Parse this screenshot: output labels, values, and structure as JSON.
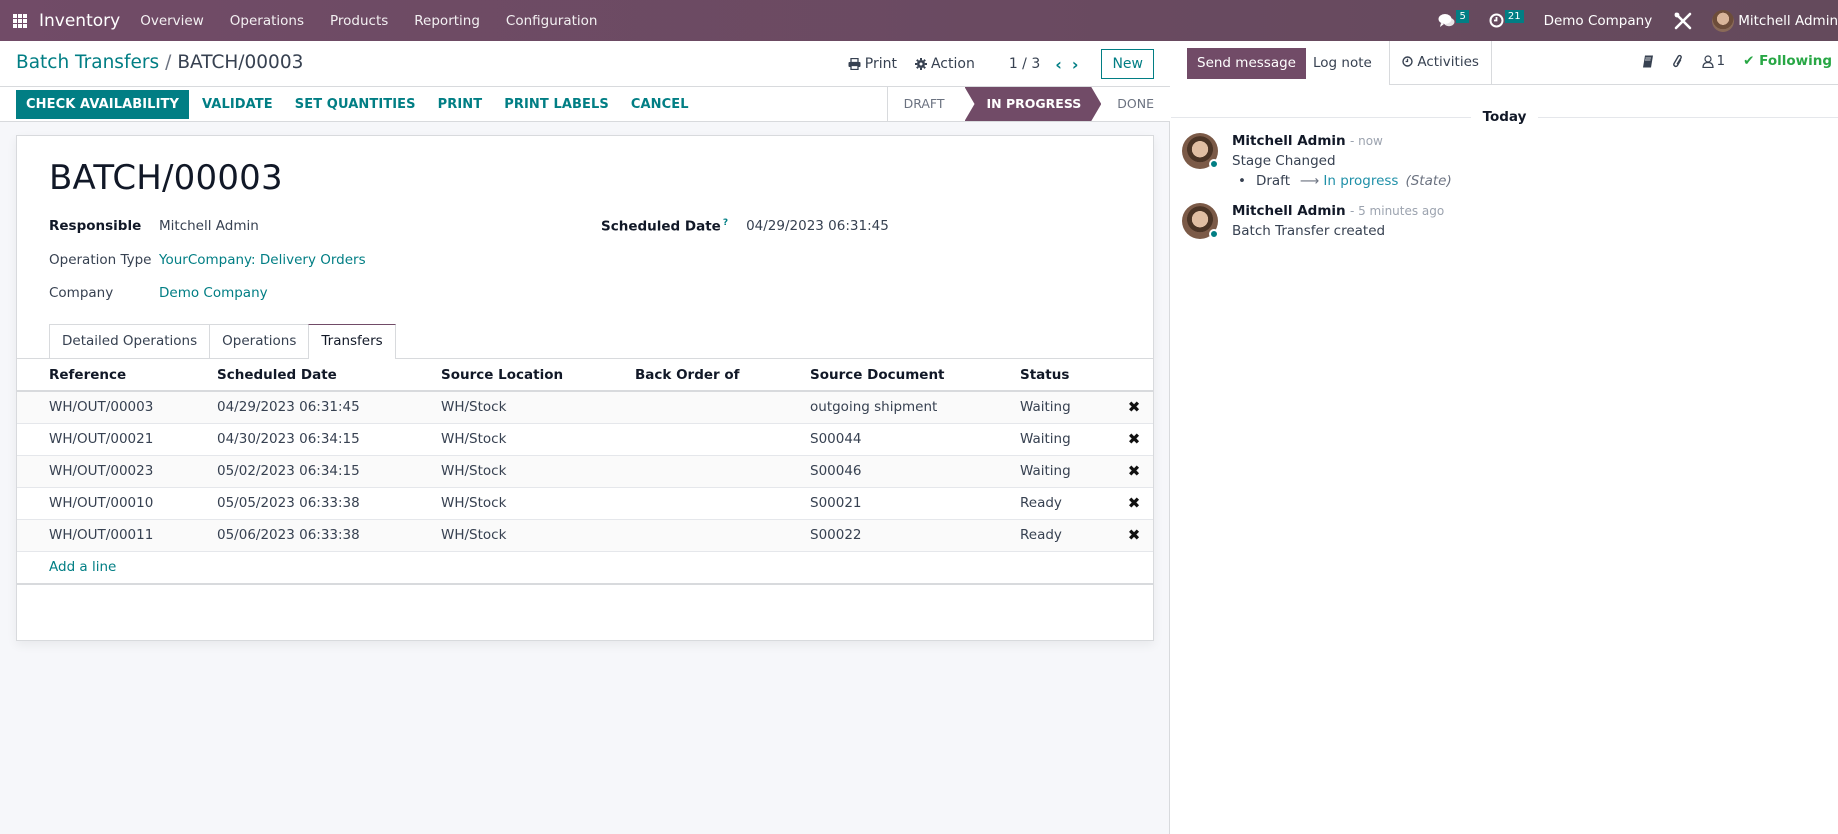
{
  "navbar": {
    "app_name": "Inventory",
    "menu": [
      "Overview",
      "Operations",
      "Products",
      "Reporting",
      "Configuration"
    ],
    "messages_count": "5",
    "activities_count": "21",
    "company": "Demo Company",
    "user": "Mitchell Admin"
  },
  "control_panel": {
    "breadcrumb_parent": "Batch Transfers",
    "breadcrumb_separator": "/",
    "breadcrumb_current": "BATCH/00003",
    "print_label": "Print",
    "action_label": "Action",
    "pager": "1 / 3",
    "new_label": "New",
    "buttons": [
      "CHECK AVAILABILITY",
      "VALIDATE",
      "SET QUANTITIES",
      "PRINT",
      "PRINT LABELS",
      "CANCEL"
    ],
    "stages": [
      "DRAFT",
      "IN PROGRESS",
      "DONE"
    ],
    "active_stage": "IN PROGRESS"
  },
  "form": {
    "title": "BATCH/00003",
    "responsible_label": "Responsible",
    "responsible_value": "Mitchell Admin",
    "operation_type_label": "Operation Type",
    "operation_type_value": "YourCompany: Delivery Orders",
    "company_label": "Company",
    "company_value": "Demo Company",
    "scheduled_date_label": "Scheduled Date",
    "scheduled_date_help": "?",
    "scheduled_date_value": "04/29/2023 06:31:45",
    "tabs": [
      "Detailed Operations",
      "Operations",
      "Transfers"
    ],
    "active_tab": "Transfers",
    "table": {
      "columns": [
        "Reference",
        "Scheduled Date",
        "Source Location",
        "Back Order of",
        "Source Document",
        "Status"
      ],
      "rows": [
        {
          "reference": "WH/OUT/00003",
          "scheduled_date": "04/29/2023 06:31:45",
          "source_location": "WH/Stock",
          "back_order_of": "",
          "source_document": "outgoing shipment",
          "status": "Waiting"
        },
        {
          "reference": "WH/OUT/00021",
          "scheduled_date": "04/30/2023 06:34:15",
          "source_location": "WH/Stock",
          "back_order_of": "",
          "source_document": "S00044",
          "status": "Waiting"
        },
        {
          "reference": "WH/OUT/00023",
          "scheduled_date": "05/02/2023 06:34:15",
          "source_location": "WH/Stock",
          "back_order_of": "",
          "source_document": "S00046",
          "status": "Waiting"
        },
        {
          "reference": "WH/OUT/00010",
          "scheduled_date": "05/05/2023 06:33:38",
          "source_location": "WH/Stock",
          "back_order_of": "",
          "source_document": "S00021",
          "status": "Ready"
        },
        {
          "reference": "WH/OUT/00011",
          "scheduled_date": "05/06/2023 06:33:38",
          "source_location": "WH/Stock",
          "back_order_of": "",
          "source_document": "S00022",
          "status": "Ready"
        }
      ],
      "add_line_label": "Add a line",
      "delete_glyph": "✖"
    }
  },
  "chatter": {
    "send_message_label": "Send message",
    "log_note_label": "Log note",
    "activities_label": "Activities",
    "followers_count": "1",
    "following_label": "Following",
    "day_separator": "Today",
    "messages": [
      {
        "author": "Mitchell Admin",
        "date": "- now",
        "text": "Stage Changed",
        "tracking": {
          "old": "Draft",
          "arrow": "⟶",
          "new": "In progress",
          "field": "(State)"
        }
      },
      {
        "author": "Mitchell Admin",
        "date": "- 5 minutes ago",
        "text": "Batch Transfer created"
      }
    ]
  },
  "colors": {
    "brand": "#714b67",
    "accent": "#017e84",
    "following": "#28a745"
  }
}
